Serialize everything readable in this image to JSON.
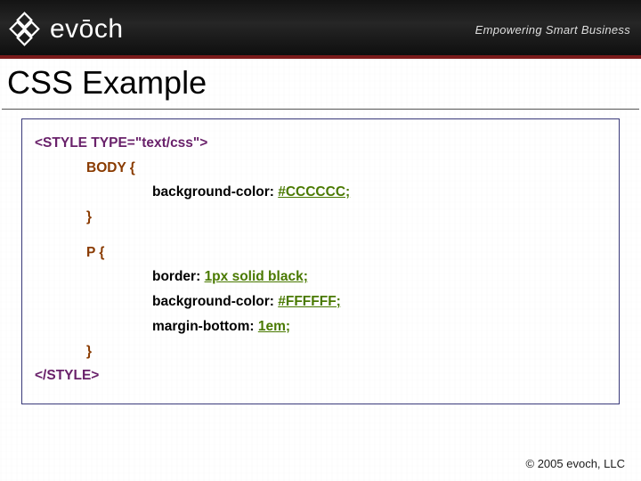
{
  "header": {
    "brand": "evōch",
    "tagline": "Empowering Smart Business"
  },
  "title": "CSS Example",
  "code": {
    "open_tag": "<STYLE TYPE=\"text/css\">",
    "body_selector": "BODY {",
    "body_bg_prop": "background-color: ",
    "body_bg_val": "#CCCCCC;",
    "body_close": "}",
    "p_selector": "P {",
    "p_border_prop": "border: ",
    "p_border_val": "1px solid black;",
    "p_bg_prop": "background-color: ",
    "p_bg_val": "#FFFFFF;",
    "p_margin_prop": "margin-bottom: ",
    "p_margin_val": "1em;",
    "p_close": "}",
    "close_tag": "</STYLE>"
  },
  "footer": "© 2005  evoch, LLC"
}
